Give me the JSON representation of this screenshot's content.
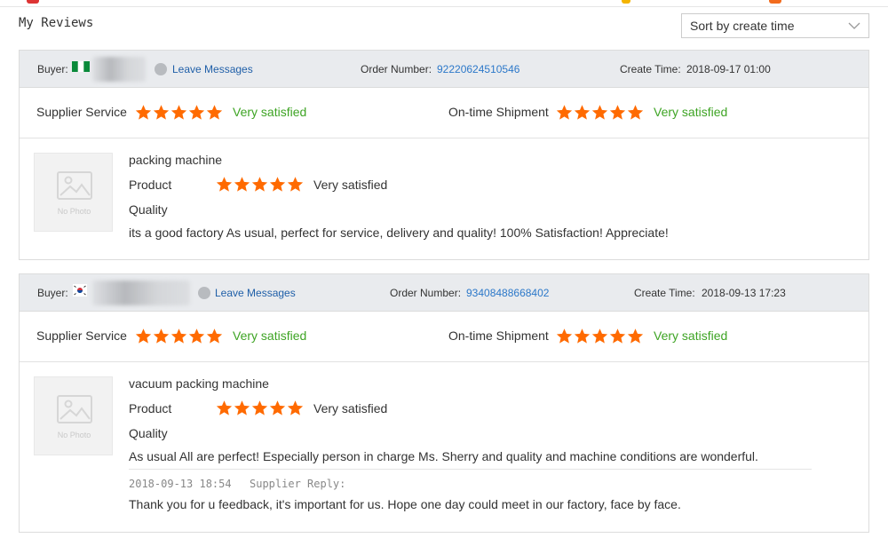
{
  "page": {
    "title": "My Reviews"
  },
  "sort": {
    "label": "Sort by create time"
  },
  "colors": {
    "star": "#ff6a00",
    "satisfied": "#3ea424",
    "link": "#2c78c9",
    "header_bg": "#e9ebee"
  },
  "labels": {
    "buyer": "Buyer:",
    "leave_messages": "Leave Messages",
    "order_number": "Order Number:",
    "create_time": "Create Time:",
    "supplier_service": "Supplier Service",
    "ontime_shipment": "On-time Shipment",
    "product": "Product",
    "quality": "Quality",
    "no_photo": "No Photo",
    "supplier_reply": "Supplier Reply:"
  },
  "reviews": [
    {
      "buyer_flag": "nigeria-flag-icon",
      "order_number": "92220624510546",
      "create_time": "2018-09-17 01:00",
      "supplier_service": {
        "stars": 5,
        "text": "Very satisfied"
      },
      "ontime_shipment": {
        "stars": 5,
        "text": "Very satisfied"
      },
      "product_name": "packing machine",
      "product_rating": {
        "stars": 5,
        "text": "Very satisfied"
      },
      "comment": "its a good factory As usual, perfect for service, delivery and quality! 100% Satisfaction! Appreciate!"
    },
    {
      "buyer_flag": "south-korea-flag-icon",
      "order_number": "93408488668402",
      "create_time": "2018-09-13 17:23",
      "supplier_service": {
        "stars": 5,
        "text": "Very satisfied"
      },
      "ontime_shipment": {
        "stars": 5,
        "text": "Very satisfied"
      },
      "product_name": "vacuum packing machine",
      "product_rating": {
        "stars": 5,
        "text": "Very satisfied"
      },
      "comment": "As usual All are perfect! Especially person in charge Ms. Sherry and quality and machine conditions are wonderful.",
      "reply": {
        "time": "2018-09-13 18:54",
        "text": "Thank you for u feedback, it's important for us. Hope one day could meet in our factory, face by face."
      }
    }
  ]
}
